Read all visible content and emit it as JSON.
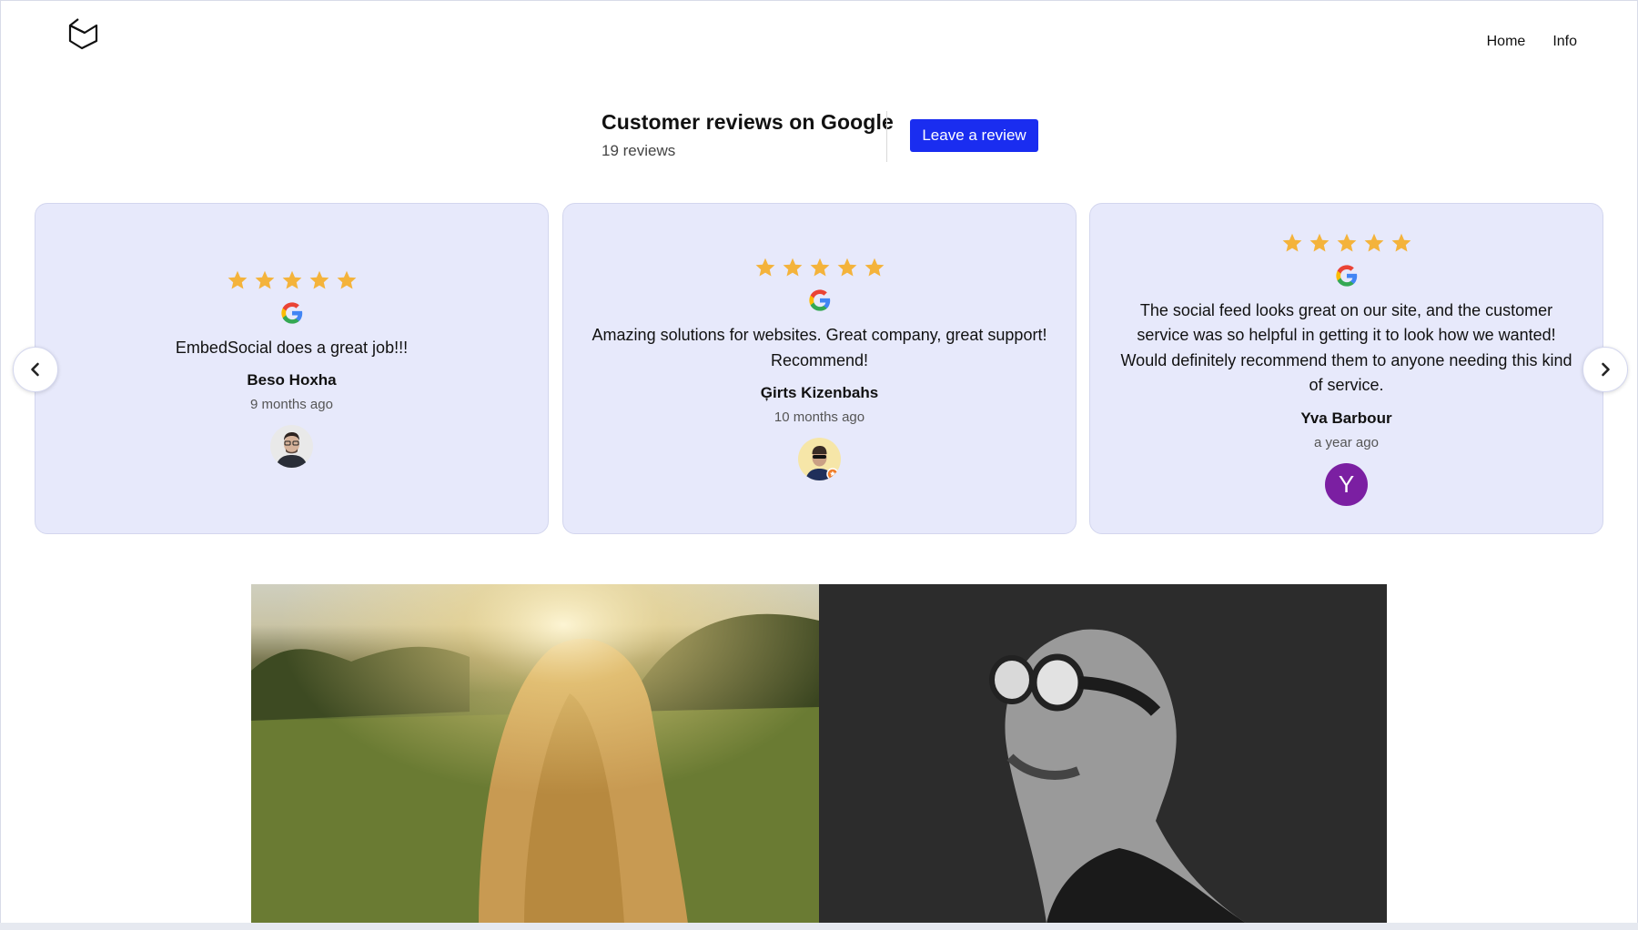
{
  "nav": {
    "home": "Home",
    "info": "Info"
  },
  "reviews_header": {
    "title": "Customer reviews on Google",
    "count": "19 reviews",
    "cta": "Leave a review"
  },
  "reviews": [
    {
      "rating": 5,
      "text": "EmbedSocial does a great job!!!",
      "name": "Beso Hoxha",
      "ago": "9 months ago"
    },
    {
      "rating": 5,
      "text": "Amazing solutions for websites. Great company, great support! Recommend!",
      "name": "Ģirts Kizenbahs",
      "ago": "10 months ago"
    },
    {
      "rating": 5,
      "text": "The social feed looks great on our site, and the customer service was so helpful in getting it to look how we wanted! Would definitely recommend them to anyone needing this kind of service.",
      "name": "Yva Barbour",
      "ago": "a year ago",
      "avatar_initial": "Y"
    }
  ],
  "colors": {
    "accent": "#1a2df0",
    "card_bg": "#e7e9fb",
    "star": "#f4b33b",
    "avatar_purple": "#7b1fa2"
  },
  "icons": {
    "logo": "envelope-logo-icon",
    "star": "star-icon",
    "google": "google-logo-icon",
    "prev": "chevron-left-icon",
    "next": "chevron-right-icon"
  }
}
